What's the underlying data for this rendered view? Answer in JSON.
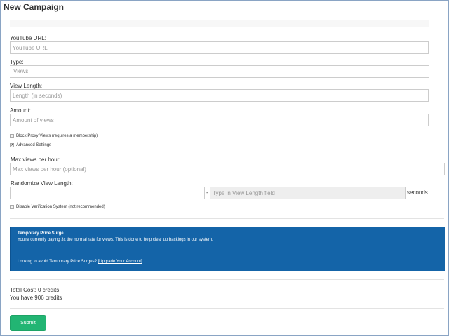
{
  "page": {
    "title": "New Campaign"
  },
  "form": {
    "youtube_url": {
      "label": "YouTube URL:",
      "placeholder": "YouTube URL"
    },
    "type": {
      "label": "Type:",
      "value": "Views"
    },
    "view_length": {
      "label": "View Length:",
      "placeholder": "Length (in seconds)"
    },
    "amount": {
      "label": "Amount:",
      "placeholder": "Amount of views"
    },
    "block_proxy": {
      "label": "Block Proxy Views (requires a membership)",
      "checked": false,
      "mark": ""
    },
    "advanced": {
      "label": "Advanced Settings",
      "checked": true,
      "mark": "✔"
    },
    "max_views": {
      "label": "Max views per hour:",
      "placeholder": "Max views per hour (optional)"
    },
    "randomize": {
      "label": "Randomize View Length:",
      "separator": "-",
      "second_placeholder": "Type in View Length field",
      "unit": "seconds"
    },
    "disable_verification": {
      "label": "Disable Verification System (not recommended)",
      "checked": false,
      "mark": ""
    }
  },
  "alert": {
    "title": "Temporary Price Surge",
    "message": "You're currently paying 3x the normal rate for views. This is done to help clear up backlogs in our system.",
    "footer_text": "Looking to avoid Temporary Price Surges?",
    "link_text": "[Upgrade Your Account]",
    "color": "#1464a8"
  },
  "totals": {
    "total_cost": "Total Cost: 0 credits",
    "balance": "You have 906 credits"
  },
  "actions": {
    "submit_label": "Submit",
    "submit_color": "#22b573"
  }
}
